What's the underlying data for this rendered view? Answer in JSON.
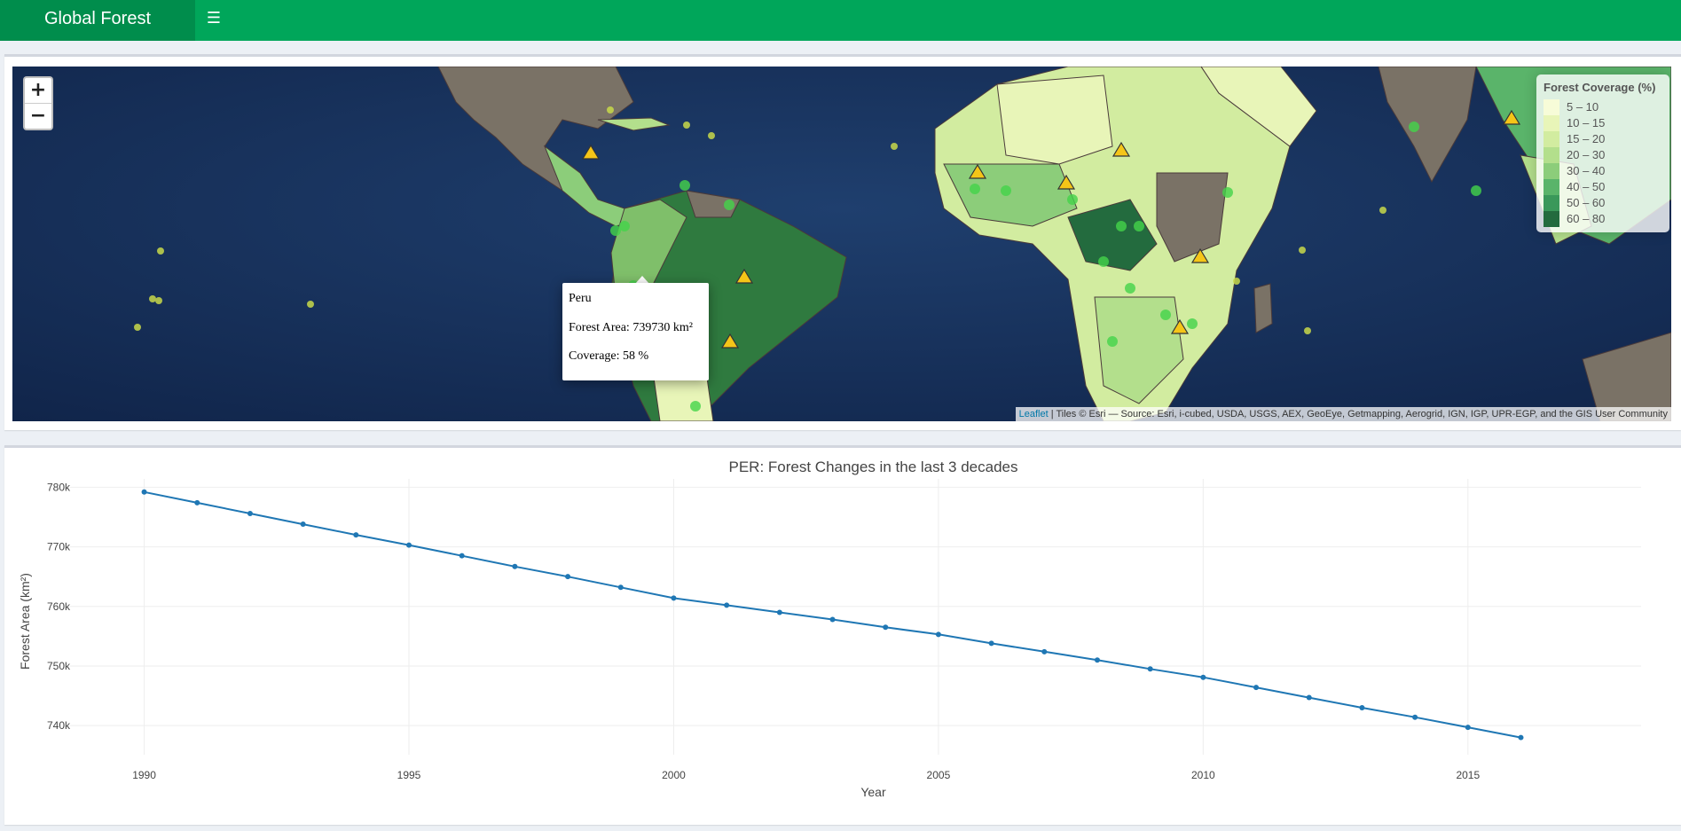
{
  "app": {
    "title": "Global Forest",
    "menu_icon": "hamburger-menu-icon"
  },
  "map": {
    "zoom_in_label": "+",
    "zoom_out_label": "−",
    "legend": {
      "title": "Forest Coverage (%)",
      "items": [
        {
          "label": "5 – 10",
          "color": "#f7fcd8"
        },
        {
          "label": "10 – 15",
          "color": "#e8f5b8"
        },
        {
          "label": "15 – 20",
          "color": "#d2eca0"
        },
        {
          "label": "20 – 30",
          "color": "#b3df8c"
        },
        {
          "label": "30 – 40",
          "color": "#8ccd7a"
        },
        {
          "label": "40 – 50",
          "color": "#5ab46a"
        },
        {
          "label": "50 – 60",
          "color": "#3a985a"
        },
        {
          "label": "60 – 80",
          "color": "#236b3e"
        }
      ]
    },
    "popup": {
      "country": "Peru",
      "forest_area": "Forest Area: 739730 km²",
      "coverage": "Coverage: 58 %"
    },
    "attribution": {
      "link": "Leaflet",
      "text": " | Tiles © Esri — Source: Esri, i-cubed, USDA, USGS, AEX, GeoEye, Getmapping, Aerogrid, IGN, IGP, UPR-EGP, and the GIS User Community"
    }
  },
  "chart_data": {
    "type": "line",
    "title": "PER: Forest Changes in the last 3 decades",
    "xlabel": "Year",
    "ylabel": "Forest Area (km²)",
    "x": [
      1990,
      1991,
      1992,
      1993,
      1994,
      1995,
      1996,
      1997,
      1998,
      1999,
      2000,
      2001,
      2002,
      2003,
      2004,
      2005,
      2006,
      2007,
      2008,
      2009,
      2010,
      2011,
      2012,
      2013,
      2014,
      2015,
      2016
    ],
    "y": [
      779200,
      777400,
      775600,
      773800,
      772000,
      770300,
      768500,
      766700,
      765000,
      763200,
      761400,
      760200,
      759000,
      757800,
      756500,
      755300,
      753800,
      752400,
      751000,
      749500,
      748100,
      746400,
      744700,
      743000,
      741400,
      739700,
      738000
    ],
    "xlim": [
      1988.6,
      2017.6
    ],
    "ylim": [
      736000,
      781400
    ],
    "x_ticks": [
      1990,
      1995,
      2000,
      2005,
      2010,
      2015
    ],
    "y_ticks": [
      740000,
      750000,
      760000,
      770000,
      780000
    ],
    "y_tick_labels": [
      "740k",
      "750k",
      "760k",
      "770k",
      "780k"
    ],
    "grid": true,
    "line_color": "#1f77b4"
  }
}
